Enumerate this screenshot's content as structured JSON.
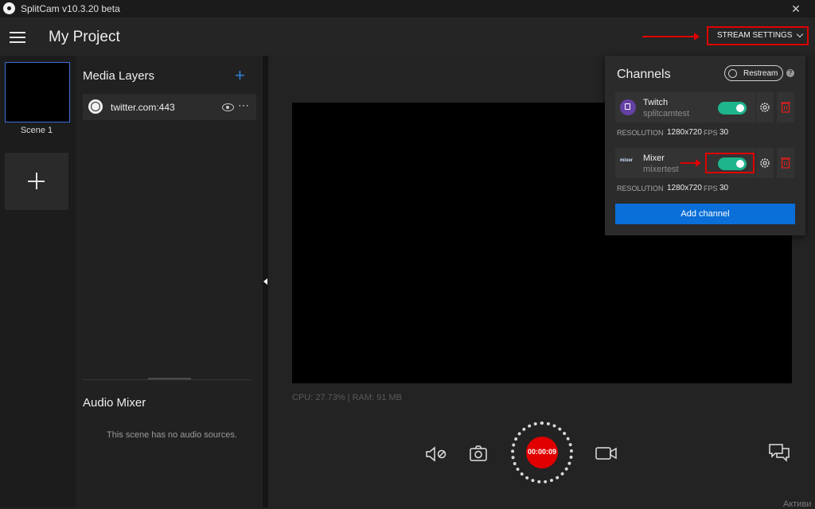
{
  "app": {
    "title": "SplitCam v10.3.20 beta",
    "close_glyph": "✕"
  },
  "header": {
    "project_title": "My Project",
    "stream_settings_label": "STREAM SETTINGS"
  },
  "scenes": {
    "items": [
      {
        "label": "Scene 1"
      }
    ]
  },
  "layers": {
    "title": "Media Layers",
    "add_glyph": "+",
    "items": [
      {
        "name": "twitter.com:443"
      }
    ],
    "more_glyph": "⋯"
  },
  "audio_mixer": {
    "title": "Audio Mixer",
    "empty_text": "This scene has no audio sources."
  },
  "preview": {
    "stats": "CPU: 27.73% | RAM: 91 MB"
  },
  "controls": {
    "record_time": "00:00:09"
  },
  "channels": {
    "title": "Channels",
    "restream_label": "Restream",
    "help_glyph": "?",
    "items": [
      {
        "name": "Twitch",
        "account": "splitcamtest",
        "enabled": true,
        "resolution_label": "RESOLUTION",
        "resolution": "1280x720",
        "fps_label": "FPS",
        "fps": "30"
      },
      {
        "name": "Mixer",
        "account": "mixertest",
        "logo_text": "mixer",
        "enabled": true,
        "resolution_label": "RESOLUTION",
        "resolution": "1280x720",
        "fps_label": "FPS",
        "fps": "30"
      }
    ],
    "add_channel_label": "Add channel"
  },
  "watermark": "Активи",
  "colors": {
    "accent_blue": "#0a6fd8",
    "toggle_on": "#1fb58c",
    "record_red": "#e00000",
    "annotation_red": "#e00000"
  },
  "icons": [
    "menu-icon",
    "plus-icon",
    "globe-icon",
    "eye-icon",
    "more-icon",
    "mic-muted-icon",
    "camera-icon",
    "video-icon",
    "chat-icon",
    "gear-icon",
    "trash-icon",
    "twitch-icon",
    "mixer-icon",
    "help-icon",
    "chevron-down-icon",
    "close-icon"
  ]
}
